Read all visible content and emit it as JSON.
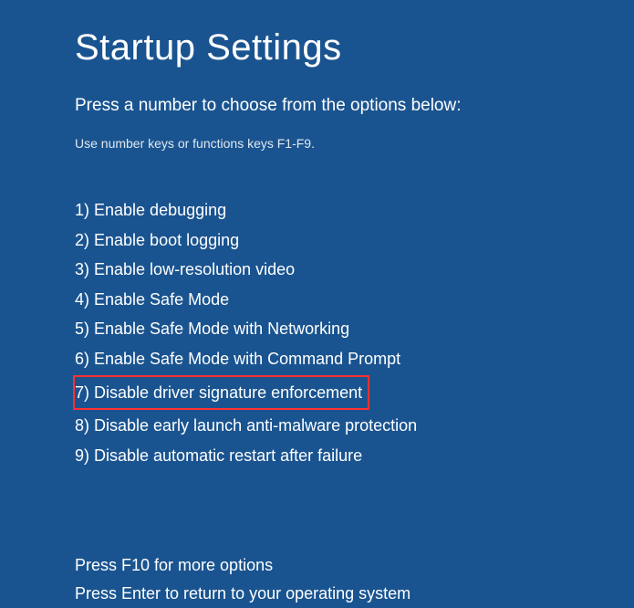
{
  "header": {
    "title": "Startup Settings",
    "subtitle": "Press a number to choose from the options below:",
    "instruction": "Use number keys or functions keys F1-F9."
  },
  "options": [
    {
      "num": "1",
      "label": "Enable debugging",
      "highlighted": false
    },
    {
      "num": "2",
      "label": "Enable boot logging",
      "highlighted": false
    },
    {
      "num": "3",
      "label": "Enable low-resolution video",
      "highlighted": false
    },
    {
      "num": "4",
      "label": "Enable Safe Mode",
      "highlighted": false
    },
    {
      "num": "5",
      "label": "Enable Safe Mode with Networking",
      "highlighted": false
    },
    {
      "num": "6",
      "label": "Enable Safe Mode with Command Prompt",
      "highlighted": false
    },
    {
      "num": "7",
      "label": "Disable driver signature enforcement",
      "highlighted": true
    },
    {
      "num": "8",
      "label": "Disable early launch anti-malware protection",
      "highlighted": false
    },
    {
      "num": "9",
      "label": "Disable automatic restart after failure",
      "highlighted": false
    }
  ],
  "footer": {
    "more_options": "Press F10 for more options",
    "return_text": "Press Enter to return to your operating system"
  }
}
